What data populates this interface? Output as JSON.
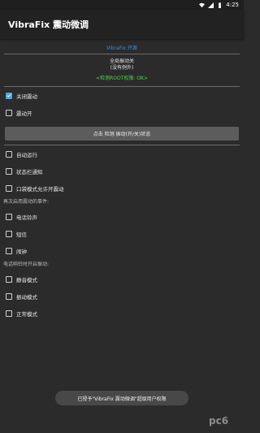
{
  "status_bar": {
    "time": "4:25"
  },
  "app": {
    "title": "VibraFix 震动微调"
  },
  "header": {
    "link": "VibraFix 开源",
    "global_line1": "全局振动关",
    "global_line2": "(没有例外)",
    "root_status": "<检测ROOT权限: OK>"
  },
  "options_top": [
    {
      "label": "关闭震动",
      "checked": true
    },
    {
      "label": "震动开",
      "checked": false
    }
  ],
  "main_button": "点击 检测 振动(开/关)状态",
  "options_mid": [
    {
      "label": "自动运行",
      "checked": false
    },
    {
      "label": "状态栏通知",
      "checked": false
    },
    {
      "label": "口袋模式允许开震动",
      "checked": false
    }
  ],
  "section1_label": "再次启用震动的事件:",
  "options_events": [
    {
      "label": "电话铃声",
      "checked": false
    },
    {
      "label": "短信",
      "checked": false
    },
    {
      "label": "闹钟",
      "checked": false
    }
  ],
  "section2_label": "电话响铃时开启振动:",
  "options_ring": [
    {
      "label": "静音模式",
      "checked": false
    },
    {
      "label": "振动模式",
      "checked": false
    },
    {
      "label": "正常模式",
      "checked": false
    }
  ],
  "toast": "已授予\"VibraFix 震动微调\"超级用户权限",
  "watermark": "pc6",
  "colors": {
    "accent": "#4ea6d6",
    "link": "#3b8ddd",
    "ok_green": "#4dd84d"
  }
}
